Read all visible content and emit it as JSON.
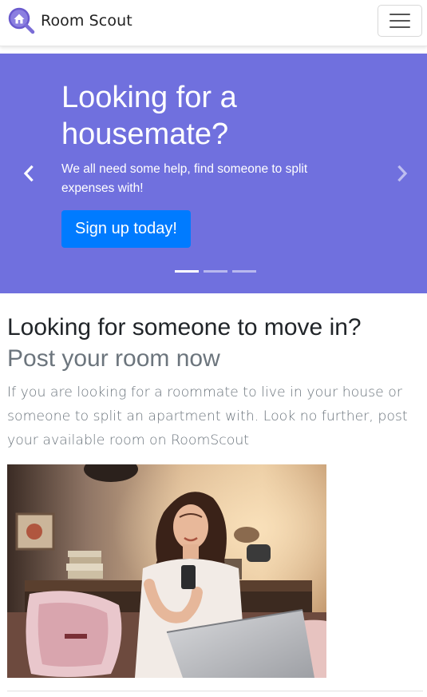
{
  "navbar": {
    "brand": "Room Scout",
    "logo_icon": "house-search-icon",
    "menu_icon": "hamburger-menu-icon",
    "accent": "#7070de"
  },
  "carousel": {
    "title": "Looking for a housemate?",
    "subtitle": "We all need some help, find someone to split expenses with!",
    "cta_label": "Sign up today!",
    "background": "#7070de",
    "cta_color": "#007bff",
    "prev_icon": "chevron-left-icon",
    "next_icon": "chevron-right-icon",
    "slide_count": 3,
    "active_slide": 1
  },
  "content": {
    "heading": "Looking for someone to move in?",
    "subheading": "Post your room now",
    "body": "If you are looking for a roommate to live in your house or someone to split an apartment with. Look no further, post your available room on RoomScout"
  }
}
